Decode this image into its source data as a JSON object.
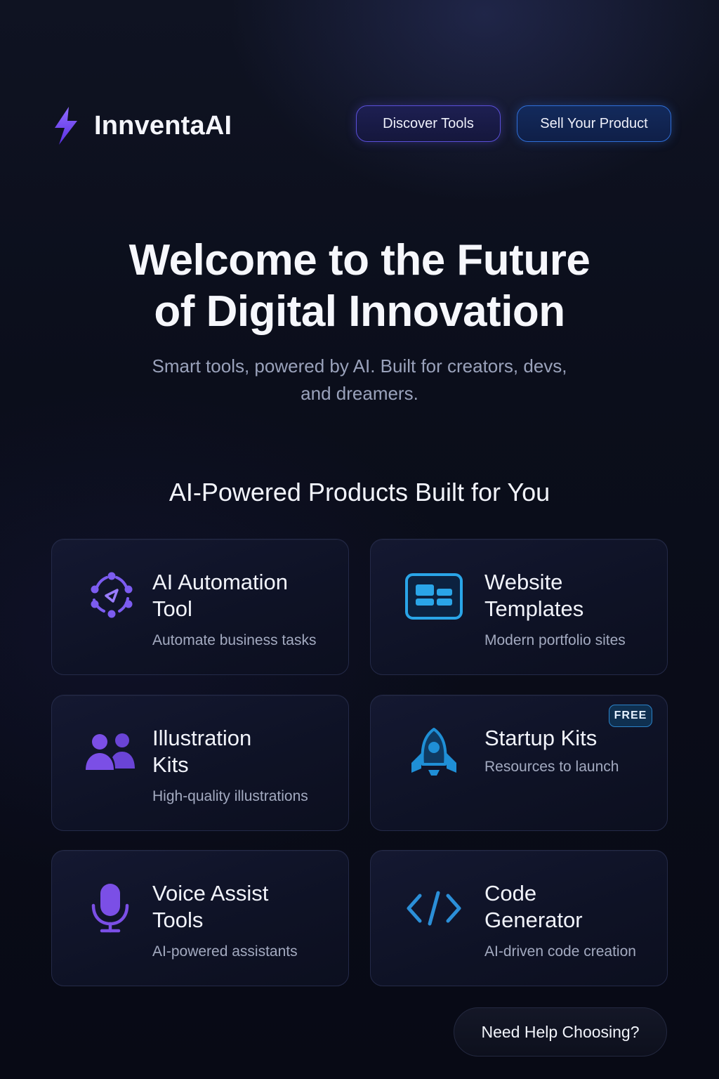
{
  "header": {
    "brand_name": "InnventaAI",
    "logo_icon": "lightning-bolt-icon",
    "discover_label": "Discover Tools",
    "sell_label": "Sell Your Product"
  },
  "hero": {
    "title_line1": "Welcome to the Future",
    "title_line2": "of Digital Innovation",
    "subtitle_line1": "Smart tools, powered by AI. Built for creators, devs,",
    "subtitle_line2": "and dreamers."
  },
  "products": {
    "section_title": "AI-Powered Products Built for You",
    "items": [
      {
        "title_line1": "AI Automation",
        "title_line2": "Tool",
        "description": "Automate business tasks",
        "icon": "automation-network-icon",
        "accent": "#7c5cf0"
      },
      {
        "title_line1": "Website",
        "title_line2": "Templates",
        "description": "Modern portfolio sites",
        "icon": "website-template-icon",
        "accent": "#2aa5e8"
      },
      {
        "title_line1": "Illustration",
        "title_line2": "Kits",
        "description": "High-quality illustrations",
        "icon": "people-icon",
        "accent": "#7b4fe6"
      },
      {
        "title_line1": "Startup Kits",
        "title_line2": "",
        "description": "Resources to launch",
        "icon": "rocket-icon",
        "accent": "#1f8fd6",
        "badge": "FREE"
      },
      {
        "title_line1": "Voice Assist",
        "title_line2": "Tools",
        "description": "AI-powered assistants",
        "icon": "microphone-icon",
        "accent": "#7b4fe6"
      },
      {
        "title_line1": "Code",
        "title_line2": "Generator",
        "description": "AI-driven code creation",
        "icon": "code-brackets-icon",
        "accent": "#2b8fd8"
      }
    ]
  },
  "help": {
    "label": "Need Help Choosing?"
  },
  "colors": {
    "background": "#0b0e1b",
    "purple_accent": "#7c5cf0",
    "blue_accent": "#2aa5e8"
  }
}
